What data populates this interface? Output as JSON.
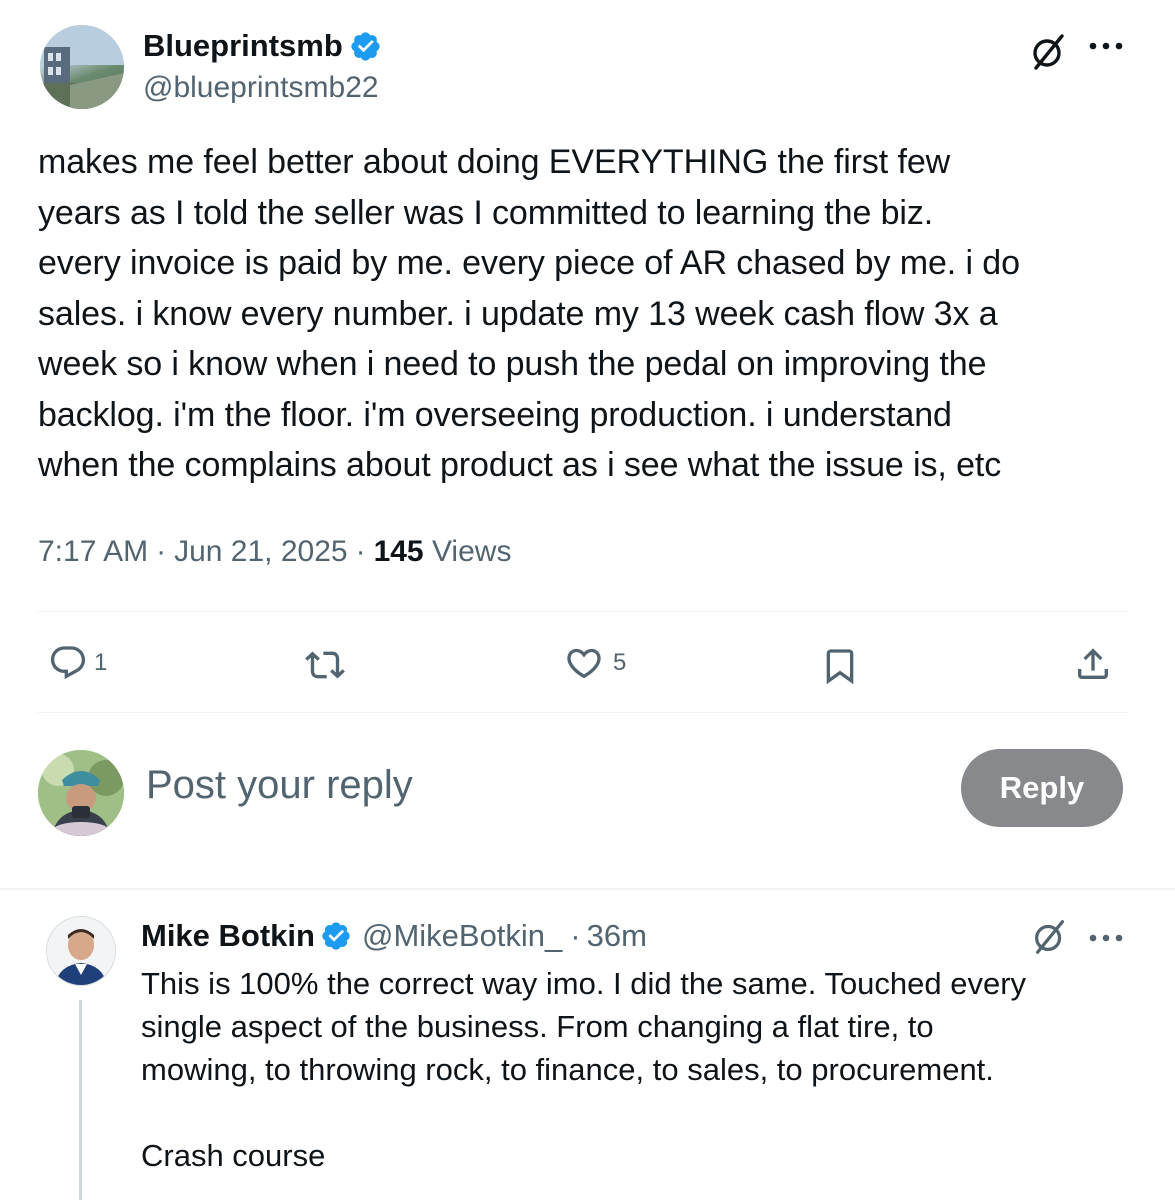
{
  "post": {
    "author_name": "Blueprintsmb",
    "author_handle": "@blueprintsmb22",
    "text_lines": [
      "makes me feel better about doing EVERYTHING the first few",
      "years as I told the seller was I committed to learning the biz.",
      "every invoice is paid by me. every piece of AR chased by me. i do",
      "sales. i know every number. i update my 13 week cash flow 3x a",
      "week so i know when i need to push the pedal on improving the",
      "backlog. i'm the floor. i'm overseeing production. i understand",
      "when the complains about product as i see what the issue is, etc"
    ],
    "time": "7:17 AM",
    "dot": "·",
    "date": "Jun 21, 2025",
    "views_count": "145",
    "views_label": "Views",
    "reply_count": "1",
    "like_count": "5"
  },
  "composer": {
    "placeholder": "Post your reply",
    "reply_button": "Reply"
  },
  "reply": {
    "author_name": "Mike Botkin",
    "author_handle": "@MikeBotkin_",
    "time_sep": "·",
    "time": "36m",
    "text_lines": [
      "This is 100% the correct way imo. I did the same. Touched every",
      "single aspect of the business. From changing a flat tire, to",
      "mowing, to throwing rock, to finance, to sales, to procurement."
    ],
    "text_line_4": "Crash course"
  },
  "colors": {
    "verified": "#1d9bf0",
    "reply_button_bg": "#87898c",
    "muted": "#536471"
  },
  "icons": [
    "verified-badge-icon",
    "grok-icon",
    "more-icon",
    "reply-icon",
    "retweet-icon",
    "like-icon",
    "bookmark-icon",
    "share-icon"
  ]
}
